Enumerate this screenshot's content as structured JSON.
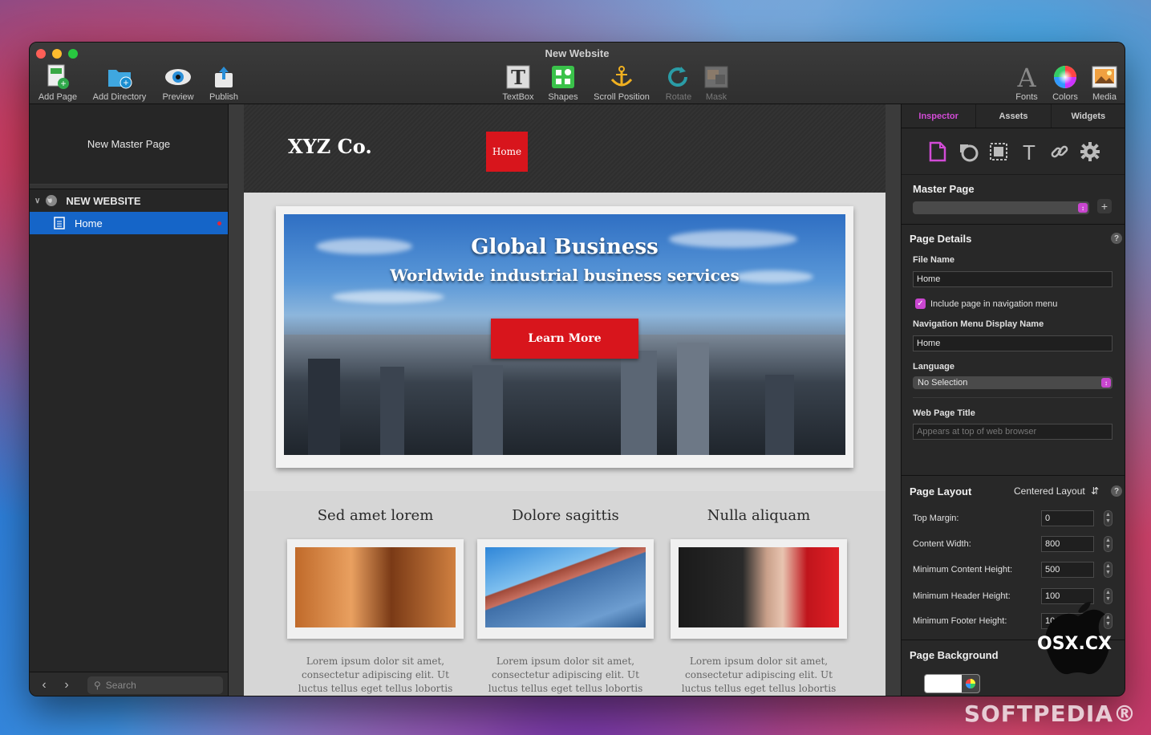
{
  "window": {
    "title": "New Website"
  },
  "toolbar": {
    "add_page": "Add Page",
    "add_directory": "Add Directory",
    "preview": "Preview",
    "publish": "Publish",
    "textbox": "TextBox",
    "shapes": "Shapes",
    "scroll_position": "Scroll Position",
    "rotate": "Rotate",
    "mask": "Mask",
    "fonts": "Fonts",
    "colors": "Colors",
    "media": "Media"
  },
  "sidebar": {
    "master_page": "New Master Page",
    "site_name": "NEW WEBSITE",
    "pages": [
      {
        "label": "Home"
      }
    ],
    "search_placeholder": "Search"
  },
  "site": {
    "logo": "XYZ Co.",
    "nav_home": "Home",
    "hero_title": "Global Business",
    "hero_subtitle": "Worldwide industrial business services",
    "hero_button": "Learn More",
    "columns": [
      {
        "title": "Sed amet lorem",
        "text": "Lorem ipsum dolor sit amet, consectetur adipiscing elit. Ut luctus tellus eget tellus lobortis"
      },
      {
        "title": "Dolore sagittis",
        "text": "Lorem ipsum dolor sit amet, consectetur adipiscing elit. Ut luctus tellus eget tellus lobortis"
      },
      {
        "title": "Nulla aliquam",
        "text": "Lorem ipsum dolor sit amet, consectetur adipiscing elit. Ut luctus tellus eget tellus lobortis"
      }
    ]
  },
  "inspector": {
    "tabs": [
      "Inspector",
      "Assets",
      "Widgets"
    ],
    "master_page_label": "Master Page",
    "page_details_label": "Page Details",
    "file_name_label": "File Name",
    "file_name_value": "Home",
    "include_nav_label": "Include page in navigation menu",
    "nav_display_label": "Navigation Menu Display Name",
    "nav_display_value": "Home",
    "language_label": "Language",
    "language_value": "No Selection",
    "web_title_label": "Web Page Title",
    "web_title_placeholder": "Appears at top of web browser",
    "page_layout_label": "Page Layout",
    "page_layout_value": "Centered Layout",
    "layout_fields": [
      {
        "label": "Top Margin:",
        "value": "0"
      },
      {
        "label": "Content Width:",
        "value": "800"
      },
      {
        "label": "Minimum Content Height:",
        "value": "500"
      },
      {
        "label": "Minimum Header Height:",
        "value": "100"
      },
      {
        "label": "Minimum Footer Height:",
        "value": "100"
      }
    ],
    "page_background_label": "Page Background"
  },
  "overlay": {
    "badge": "OSX.CX",
    "watermark": "SOFTPEDIA®"
  },
  "colors": {
    "accent": "#d24bd6",
    "selection": "#1565c8",
    "brand_red": "#d8151c"
  }
}
